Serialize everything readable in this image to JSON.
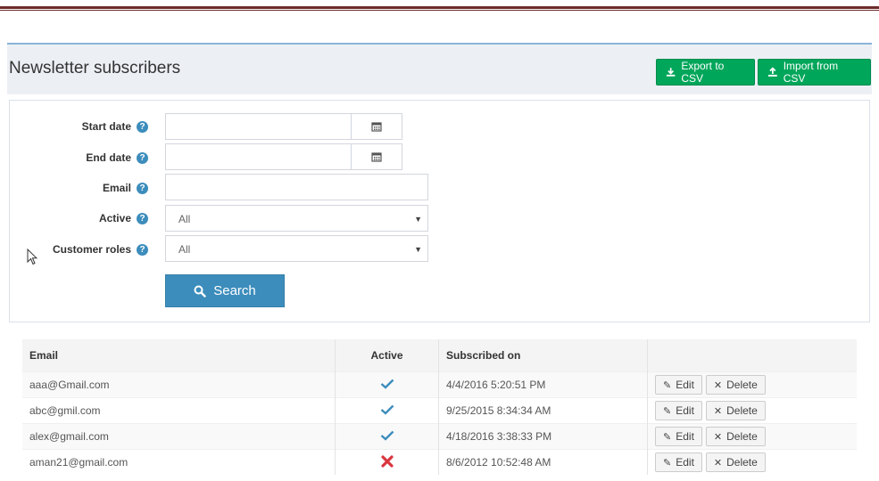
{
  "page": {
    "title": "Newsletter subscribers",
    "export_label": "Export to CSV",
    "import_label": "Import from CSV",
    "accent": "#3c8dbc",
    "green": "#00a65a"
  },
  "filters": {
    "start_date_label": "Start date",
    "end_date_label": "End date",
    "email_label": "Email",
    "active_label": "Active",
    "active_value": "All",
    "roles_label": "Customer roles",
    "roles_value": "All",
    "search_label": "Search",
    "help_glyph": "?"
  },
  "grid": {
    "headers": {
      "email": "Email",
      "active": "Active",
      "subscribed": "Subscribed on"
    },
    "edit_label": "Edit",
    "delete_label": "Delete",
    "rows": [
      {
        "email": "aaa@Gmail.com",
        "active": true,
        "subscribed": "4/4/2016 5:20:51 PM"
      },
      {
        "email": "abc@gmil.com",
        "active": true,
        "subscribed": "9/25/2015 8:34:34 AM"
      },
      {
        "email": "alex@gmail.com",
        "active": true,
        "subscribed": "4/18/2016 3:38:33 PM"
      },
      {
        "email": "aman21@gmail.com",
        "active": false,
        "subscribed": "8/6/2012 10:52:48 AM"
      }
    ]
  }
}
